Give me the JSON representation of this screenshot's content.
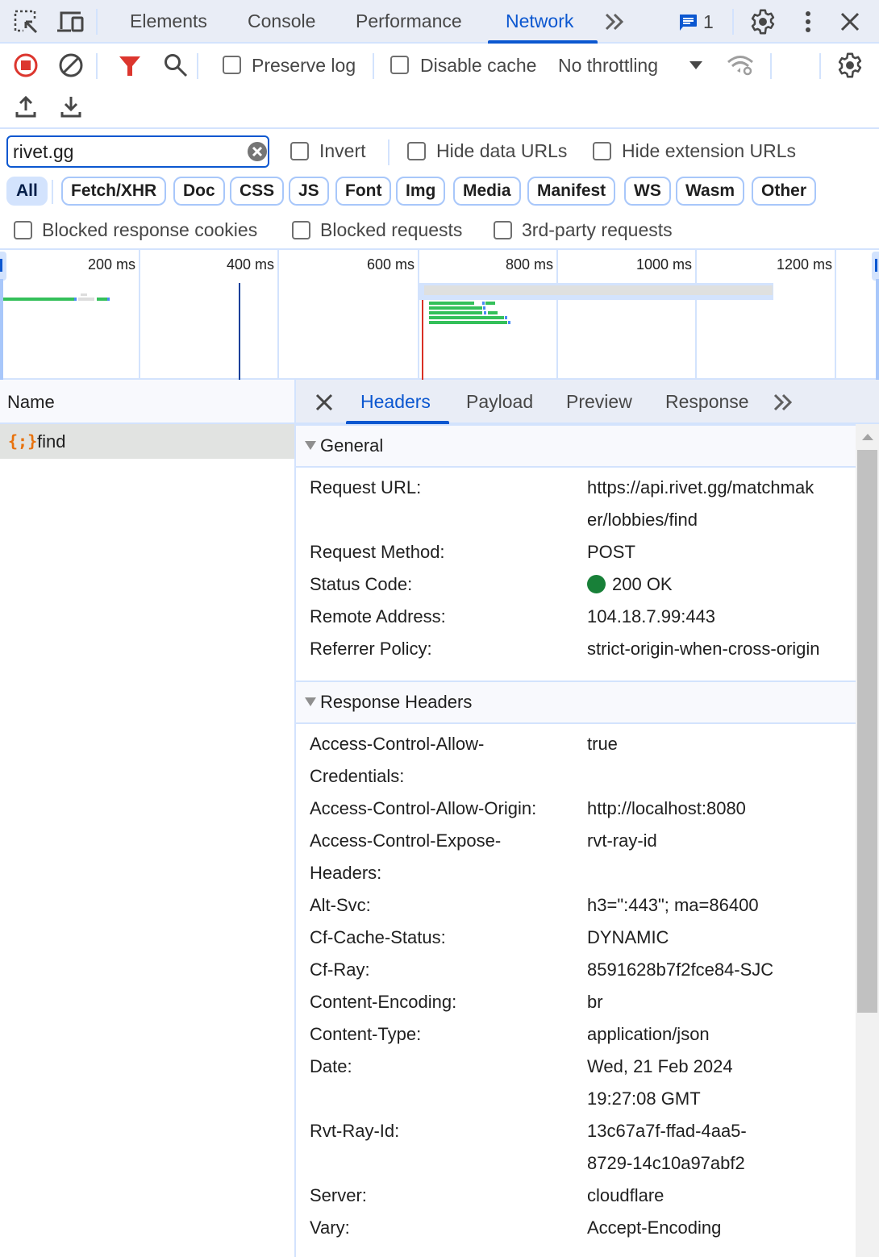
{
  "devtools": {
    "tabs": [
      {
        "label": "Elements",
        "active": false
      },
      {
        "label": "Console",
        "active": false
      },
      {
        "label": "Performance",
        "active": false
      },
      {
        "label": "Network",
        "active": true
      }
    ],
    "more_tabs_icon": "chevron-double-right-icon",
    "issues_count": "1",
    "accent_color": "#0b57d0"
  },
  "toolbar": {
    "preserve_log_label": "Preserve log",
    "preserve_log_checked": false,
    "disable_cache_label": "Disable cache",
    "disable_cache_checked": false,
    "throttling_value": "No throttling"
  },
  "filter": {
    "value": "rivet.gg",
    "invert_label": "Invert",
    "hide_data_urls_label": "Hide data URLs",
    "hide_extension_urls_label": "Hide extension URLs",
    "chips": [
      {
        "label": "All",
        "selected": true
      },
      {
        "label": "Fetch/XHR",
        "selected": false
      },
      {
        "label": "Doc",
        "selected": false
      },
      {
        "label": "CSS",
        "selected": false
      },
      {
        "label": "JS",
        "selected": false
      },
      {
        "label": "Font",
        "selected": false
      },
      {
        "label": "Img",
        "selected": false
      },
      {
        "label": "Media",
        "selected": false
      },
      {
        "label": "Manifest",
        "selected": false
      },
      {
        "label": "WS",
        "selected": false
      },
      {
        "label": "Wasm",
        "selected": false
      },
      {
        "label": "Other",
        "selected": false
      }
    ],
    "blocked_response_cookies_label": "Blocked response cookies",
    "blocked_requests_label": "Blocked requests",
    "third_party_label": "3rd-party requests"
  },
  "overview": {
    "ticks": [
      "200 ms",
      "400 ms",
      "600 ms",
      "800 ms",
      "1000 ms",
      "1200 ms"
    ],
    "dom_content_loaded_ms": 430,
    "load_ms": 630
  },
  "request_list": {
    "column_name": "Name",
    "rows": [
      {
        "name": "find",
        "type_icon": "fetch-icon",
        "selected": true
      }
    ]
  },
  "details": {
    "tabs": [
      {
        "label": "Headers",
        "active": true
      },
      {
        "label": "Payload",
        "active": false
      },
      {
        "label": "Preview",
        "active": false
      },
      {
        "label": "Response",
        "active": false
      }
    ],
    "general": {
      "title": "General",
      "rows": [
        {
          "name": "Request URL:",
          "value": "https://api.rivet.gg/matchmak\ner/lobbies/find"
        },
        {
          "name": "Request Method:",
          "value": "POST"
        },
        {
          "name": "Status Code:",
          "value": "200 OK",
          "status_color": "#188038"
        },
        {
          "name": "Remote Address:",
          "value": "104.18.7.99:443"
        },
        {
          "name": "Referrer Policy:",
          "value": "strict-origin-when-cross-origin"
        }
      ]
    },
    "response_headers": {
      "title": "Response Headers",
      "rows": [
        {
          "name": "Access-Control-Allow-\nCredentials:",
          "value": "true"
        },
        {
          "name": "Access-Control-Allow-Origin:",
          "value": "http://localhost:8080"
        },
        {
          "name": "Access-Control-Expose-\nHeaders:",
          "value": "rvt-ray-id"
        },
        {
          "name": "Alt-Svc:",
          "value": "h3=\":443\"; ma=86400"
        },
        {
          "name": "Cf-Cache-Status:",
          "value": "DYNAMIC"
        },
        {
          "name": "Cf-Ray:",
          "value": "8591628b7f2fce84-SJC"
        },
        {
          "name": "Content-Encoding:",
          "value": "br"
        },
        {
          "name": "Content-Type:",
          "value": "application/json"
        },
        {
          "name": "Date:",
          "value": "Wed, 21 Feb 2024\n19:27:08 GMT"
        },
        {
          "name": "Rvt-Ray-Id:",
          "value": "13c67a7f-ffad-4aa5-\n8729-14c10a97abf2"
        },
        {
          "name": "Server:",
          "value": "cloudflare"
        },
        {
          "name": "Vary:",
          "value": "Accept-Encoding"
        }
      ]
    }
  }
}
